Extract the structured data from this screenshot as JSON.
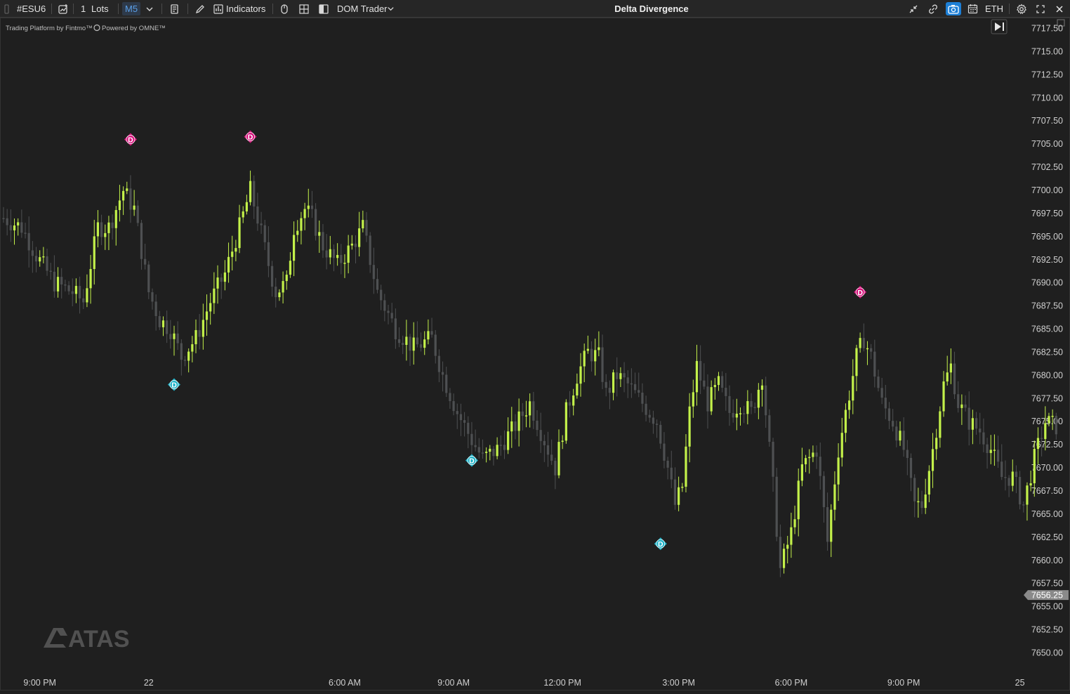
{
  "toolbar": {
    "symbol": "#ESU6",
    "lots_value": "1",
    "lots_label": "Lots",
    "timeframe": "M5",
    "indicators_label": "Indicators",
    "dom_trader_label": "DOM Trader",
    "title": "Delta Divergence",
    "session": "ETH"
  },
  "chart_info": {
    "platform_text": "Trading Platform by Fintmo™",
    "powered_text": "Powered by OMNE™",
    "watermark": "ATAS"
  },
  "colors": {
    "background": "#1f1f1f",
    "bull_candle": "#c3f14a",
    "bear_candle": "#4e5052",
    "bearish_divergence": "#d6137c",
    "bullish_divergence": "#20b3c8",
    "accent": "#1d7fd6"
  },
  "chart_data": {
    "type": "candlestick",
    "title": "Delta Divergence",
    "ylim": [
      7648.0,
      7718.5
    ],
    "y_ticks": [
      "7717.50",
      "7715.00",
      "7712.50",
      "7710.00",
      "7707.50",
      "7705.00",
      "7702.50",
      "7700.00",
      "7697.50",
      "7695.00",
      "7692.50",
      "7690.00",
      "7687.50",
      "7685.00",
      "7682.50",
      "7680.00",
      "7677.50",
      "7675.00",
      "7672.50",
      "7670.00",
      "7667.50",
      "7665.00",
      "7662.50",
      "7660.00",
      "7657.50",
      "7655.00",
      "7652.50",
      "7650.00"
    ],
    "x_ticks": [
      {
        "label": "9:00 PM",
        "t": 10
      },
      {
        "label": "22",
        "t": 40
      },
      {
        "label": "6:00 AM",
        "t": 94
      },
      {
        "label": "9:00 AM",
        "t": 124
      },
      {
        "label": "12:00 PM",
        "t": 154
      },
      {
        "label": "3:00 PM",
        "t": 186
      },
      {
        "label": "6:00 PM",
        "t": 217
      },
      {
        "label": "9:00 PM",
        "t": 248
      },
      {
        "label": "25",
        "t": 280
      }
    ],
    "current_price": "7656.25",
    "price_path": [
      [
        0,
        7697.0
      ],
      [
        5,
        7696.0
      ],
      [
        9,
        7693.0
      ],
      [
        14,
        7690.0
      ],
      [
        19,
        7689.0
      ],
      [
        22,
        7688.0
      ],
      [
        26,
        7696.0
      ],
      [
        29,
        7696.0
      ],
      [
        33,
        7700.0
      ],
      [
        36,
        7698.0
      ],
      [
        40,
        7689.0
      ],
      [
        43,
        7686.0
      ],
      [
        46,
        7685.0
      ],
      [
        49,
        7682.0
      ],
      [
        53,
        7684.0
      ],
      [
        57,
        7688.0
      ],
      [
        61,
        7691.0
      ],
      [
        65,
        7696.0
      ],
      [
        68,
        7700.0
      ],
      [
        70,
        7697.0
      ],
      [
        73,
        7692.0
      ],
      [
        75,
        7689.0
      ],
      [
        78,
        7690.0
      ],
      [
        80,
        7696.0
      ],
      [
        83,
        7698.0
      ],
      [
        85,
        7697.0
      ],
      [
        88,
        7694.0
      ],
      [
        92,
        7692.0
      ],
      [
        96,
        7694.0
      ],
      [
        99,
        7696.0
      ],
      [
        103,
        7689.0
      ],
      [
        108,
        7685.0
      ],
      [
        113,
        7683.0
      ],
      [
        118,
        7684.0
      ],
      [
        121,
        7680.0
      ],
      [
        125,
        7676.0
      ],
      [
        129,
        7673.0
      ],
      [
        132,
        7671.0
      ],
      [
        136,
        7672.0
      ],
      [
        140,
        7674.0
      ],
      [
        145,
        7677.0
      ],
      [
        149,
        7673.0
      ],
      [
        152,
        7670.0
      ],
      [
        155,
        7676.0
      ],
      [
        158,
        7680.0
      ],
      [
        161,
        7682.5
      ],
      [
        164,
        7682.0
      ],
      [
        166,
        7678.0
      ],
      [
        169,
        7680.0
      ],
      [
        172,
        7679.0
      ],
      [
        176,
        7677.0
      ],
      [
        180,
        7675.0
      ],
      [
        183,
        7670.0
      ],
      [
        185,
        7666.0
      ],
      [
        187,
        7668.0
      ],
      [
        189,
        7676.0
      ],
      [
        191,
        7681.0
      ],
      [
        194,
        7677.0
      ],
      [
        197,
        7679.0
      ],
      [
        200,
        7676.0
      ],
      [
        203,
        7677.0
      ],
      [
        206,
        7676.0
      ],
      [
        209,
        7680.0
      ],
      [
        212,
        7668.0
      ],
      [
        214,
        7659.0
      ],
      [
        217,
        7663.0
      ],
      [
        220,
        7670.0
      ],
      [
        224,
        7672.0
      ],
      [
        227,
        7662.0
      ],
      [
        230,
        7672.0
      ],
      [
        233,
        7678.0
      ],
      [
        235,
        7682.0
      ],
      [
        237,
        7684.0
      ],
      [
        239,
        7682.0
      ],
      [
        242,
        7677.0
      ],
      [
        245,
        7675.0
      ],
      [
        248,
        7672.0
      ],
      [
        251,
        7666.0
      ],
      [
        253,
        7666.0
      ],
      [
        256,
        7672.0
      ],
      [
        259,
        7679.0
      ],
      [
        261,
        7681.0
      ],
      [
        263,
        7677.0
      ],
      [
        266,
        7675.0
      ],
      [
        269,
        7674.0
      ],
      [
        272,
        7672.0
      ],
      [
        275,
        7669.0
      ],
      [
        278,
        7669.0
      ],
      [
        281,
        7666.0
      ],
      [
        284,
        7671.0
      ],
      [
        287,
        7675.0
      ],
      [
        290,
        7674.5
      ]
    ],
    "divergences": [
      {
        "type": "bearish",
        "label": "D",
        "t": 35,
        "price": 7705.5
      },
      {
        "type": "bearish",
        "label": "D",
        "t": 68,
        "price": 7705.8
      },
      {
        "type": "bearish",
        "label": "D",
        "t": 236,
        "price": 7689.0
      },
      {
        "type": "bullish",
        "label": "D",
        "t": 47,
        "price": 7679.0
      },
      {
        "type": "bullish",
        "label": "D",
        "t": 129,
        "price": 7670.8
      },
      {
        "type": "bullish",
        "label": "D",
        "t": 181,
        "price": 7661.8
      }
    ]
  }
}
